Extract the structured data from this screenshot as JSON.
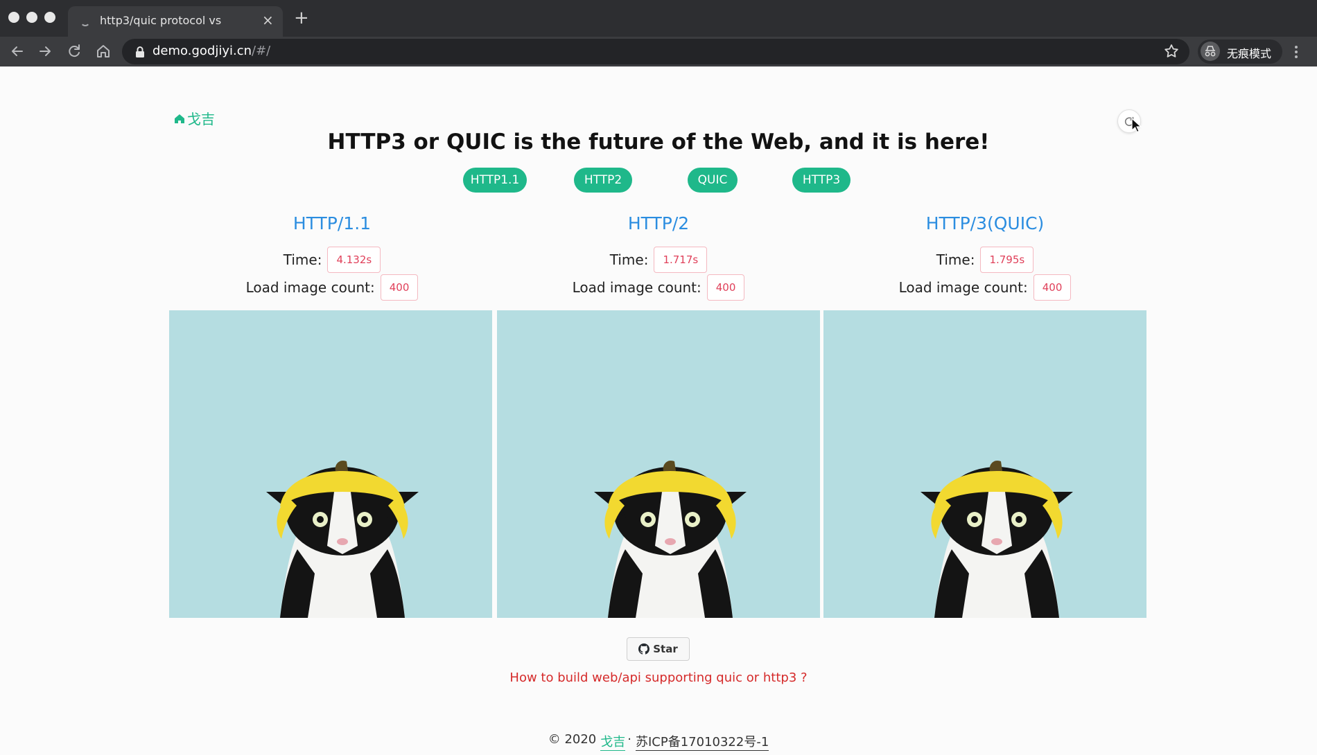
{
  "browser": {
    "tab_title": "http3/quic protocol vs",
    "tab_close": "×",
    "new_tab": "+",
    "url_host": "demo.godjiyi.cn",
    "url_path": "/#/",
    "incognito_label": "无痕模式"
  },
  "header": {
    "home_label": "戈吉",
    "title": "HTTP3 or QUIC is the future of the Web, and it is here!"
  },
  "protocol_buttons": [
    "HTTP1.1",
    "HTTP2",
    "QUIC",
    "HTTP3"
  ],
  "columns": [
    {
      "title": "HTTP/1.1",
      "time_label": "Time:",
      "time_value": "4.132s",
      "count_label": "Load image count:",
      "count_value": "400"
    },
    {
      "title": "HTTP/2",
      "time_label": "Time:",
      "time_value": "1.717s",
      "count_label": "Load image count:",
      "count_value": "400"
    },
    {
      "title": "HTTP/3(QUIC)",
      "time_label": "Time:",
      "time_value": "1.795s",
      "count_label": "Load image count:",
      "count_value": "400"
    }
  ],
  "github": {
    "star_label": "Star"
  },
  "howto_link": "How to build web/api supporting quic or http3 ?",
  "footer": {
    "copyright": "© 2020",
    "author": "戈吉",
    "separator": "·",
    "icp": "苏ICP备17010322号-1"
  },
  "colors": {
    "accent_green": "#1fb88a",
    "title_blue": "#2b8de0",
    "value_red": "#e0405a",
    "link_red": "#d52a2a",
    "image_bg": "#b5dde1"
  },
  "icons": [
    "home-icon",
    "refresh-icon",
    "github-icon",
    "lock-icon",
    "star-icon",
    "incognito-icon"
  ]
}
